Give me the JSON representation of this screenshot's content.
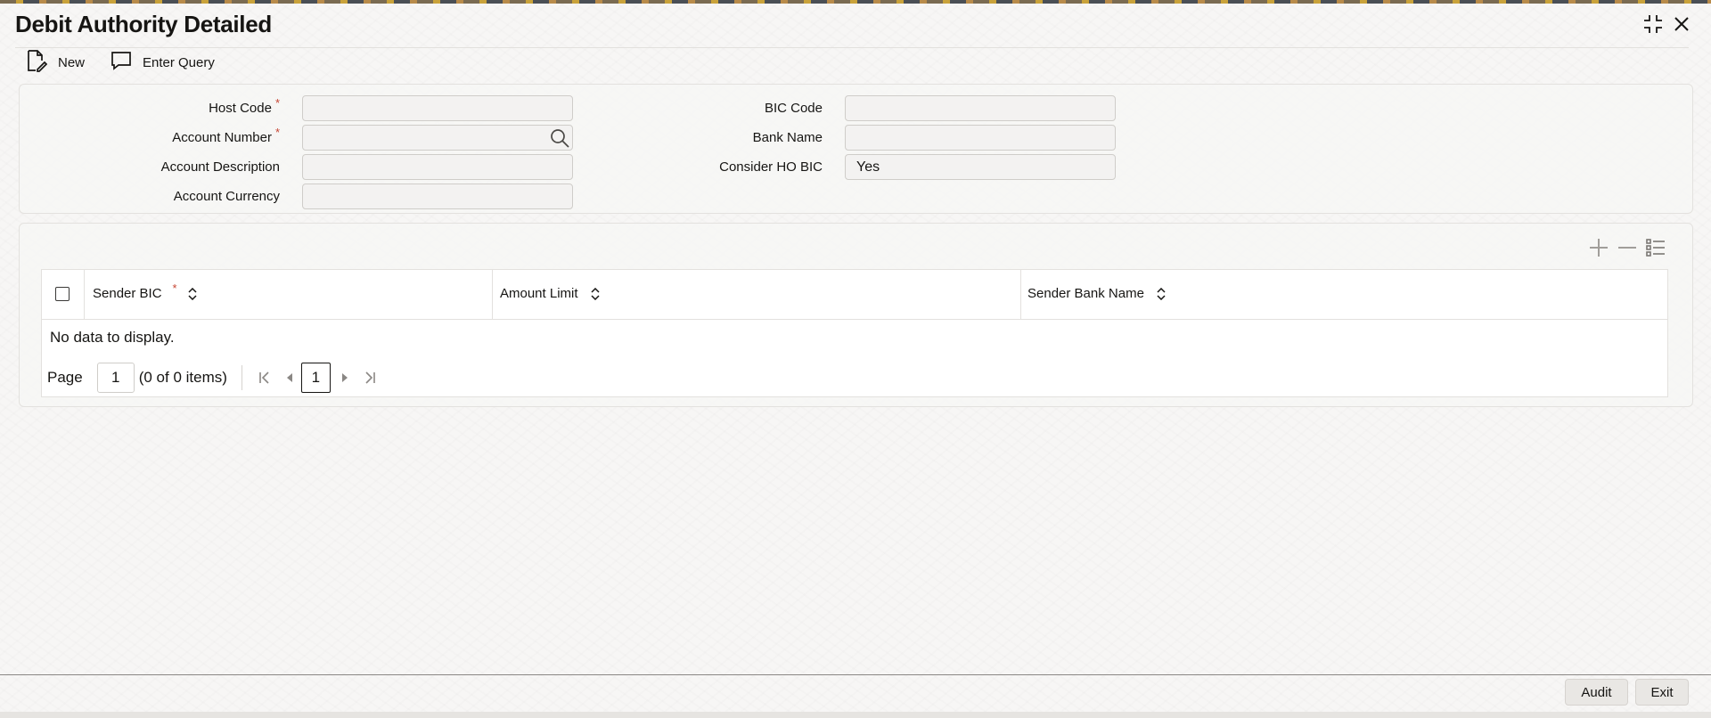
{
  "window": {
    "title": "Debit Authority Detailed"
  },
  "toolbar": {
    "new_label": "New",
    "enter_query_label": "Enter Query"
  },
  "form": {
    "host_code": {
      "label": "Host Code",
      "value": ""
    },
    "account_number": {
      "label": "Account Number",
      "value": ""
    },
    "account_description": {
      "label": "Account Description",
      "value": ""
    },
    "account_currency": {
      "label": "Account Currency",
      "value": ""
    },
    "bic_code": {
      "label": "BIC Code",
      "value": ""
    },
    "bank_name": {
      "label": "Bank Name",
      "value": ""
    },
    "consider_ho_bic": {
      "label": "Consider HO BIC",
      "value": "Yes"
    },
    "required_mark": "*"
  },
  "grid": {
    "columns": [
      {
        "label": "Sender BIC",
        "required": true
      },
      {
        "label": "Amount Limit",
        "required": false
      },
      {
        "label": "Sender Bank Name",
        "required": false
      }
    ],
    "empty_message": "No data to display.",
    "rows": []
  },
  "pagination": {
    "page_label": "Page",
    "page_input": "1",
    "items_text": "(0 of 0 items)",
    "current_page": "1"
  },
  "footer": {
    "audit_label": "Audit",
    "exit_label": "Exit"
  },
  "colors": {
    "required": "#c74634",
    "text": "#161513",
    "background": "#f7f6f5"
  }
}
